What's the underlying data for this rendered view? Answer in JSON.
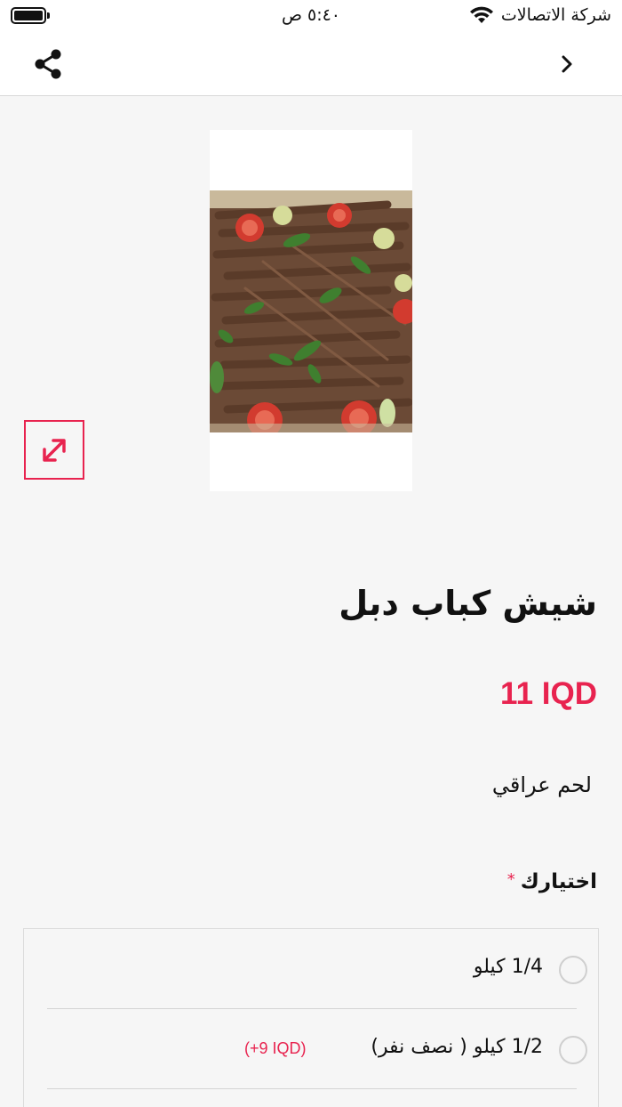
{
  "status_bar": {
    "carrier": "شركة الاتصالات",
    "time": "٥:٤٠ ص"
  },
  "product": {
    "title": "شيش كباب دبل",
    "price": "11 IQD",
    "description": "لحم عراقي"
  },
  "options": {
    "label": "اختيارك",
    "required_mark": "*",
    "items": [
      {
        "label": "1/4 كيلو",
        "extra": ""
      },
      {
        "label": "1/2 كيلو ( نصف نفر)",
        "extra": "(+9 IQD)"
      }
    ]
  },
  "colors": {
    "accent": "#e8234f",
    "background": "#f6f6f6",
    "header": "#ffffff"
  },
  "icons": {
    "share": "share-icon",
    "back": "chevron-right-icon",
    "expand": "expand-icon",
    "wifi": "wifi-icon",
    "battery": "battery-icon"
  }
}
